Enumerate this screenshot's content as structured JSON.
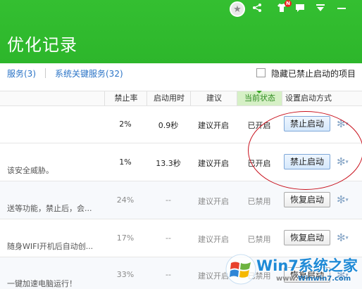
{
  "header": {
    "title": "优化记录",
    "icons": [
      "user-badge-icon",
      "share-icon",
      "shirt-icon",
      "message-icon",
      "dropdown-icon",
      "minimize-icon"
    ],
    "notification_badge": "N"
  },
  "tabs": [
    {
      "label": "服务(3)"
    },
    {
      "label": "系统关键服务(32)"
    }
  ],
  "hide_disabled": {
    "label": "隐藏已禁止启动的项目",
    "checked": false
  },
  "table": {
    "columns": [
      "禁止率",
      "启动用时",
      "建议",
      "当前状态",
      "设置启动方式"
    ],
    "active_column": "当前状态",
    "rows": [
      {
        "desc": "",
        "rate": "2%",
        "time": "0.9秒",
        "suggestion": "建议开启",
        "status": "已开启",
        "action": "禁止启动"
      },
      {
        "desc": "该安全威胁。",
        "rate": "1%",
        "time": "13.3秒",
        "suggestion": "建议开启",
        "status": "已开启",
        "action": "禁止启动"
      },
      {
        "desc": "送等功能，禁止后，会...",
        "rate": "24%",
        "time": "--",
        "suggestion": "建议开启",
        "status": "已禁用",
        "action": "恢复启动"
      },
      {
        "desc": "随身WIFI开机后自动创...",
        "rate": "17%",
        "time": "--",
        "suggestion": "建议开启",
        "status": "已禁用",
        "action": "恢复启动"
      },
      {
        "desc": "一键加速电脑运行！",
        "rate": "33%",
        "time": "--",
        "suggestion": "建议开启",
        "status": "已禁用",
        "action": "恢复启动"
      }
    ]
  },
  "watermark": {
    "brand": "Win7系统之家",
    "url_prefix": "www.",
    "url_main": "Winwin7.com"
  },
  "colors": {
    "header_green": "#2db62b",
    "link_blue": "#2a73c6",
    "annotation_red": "#c8101c",
    "active_column_bg": "#d6f0c6"
  }
}
